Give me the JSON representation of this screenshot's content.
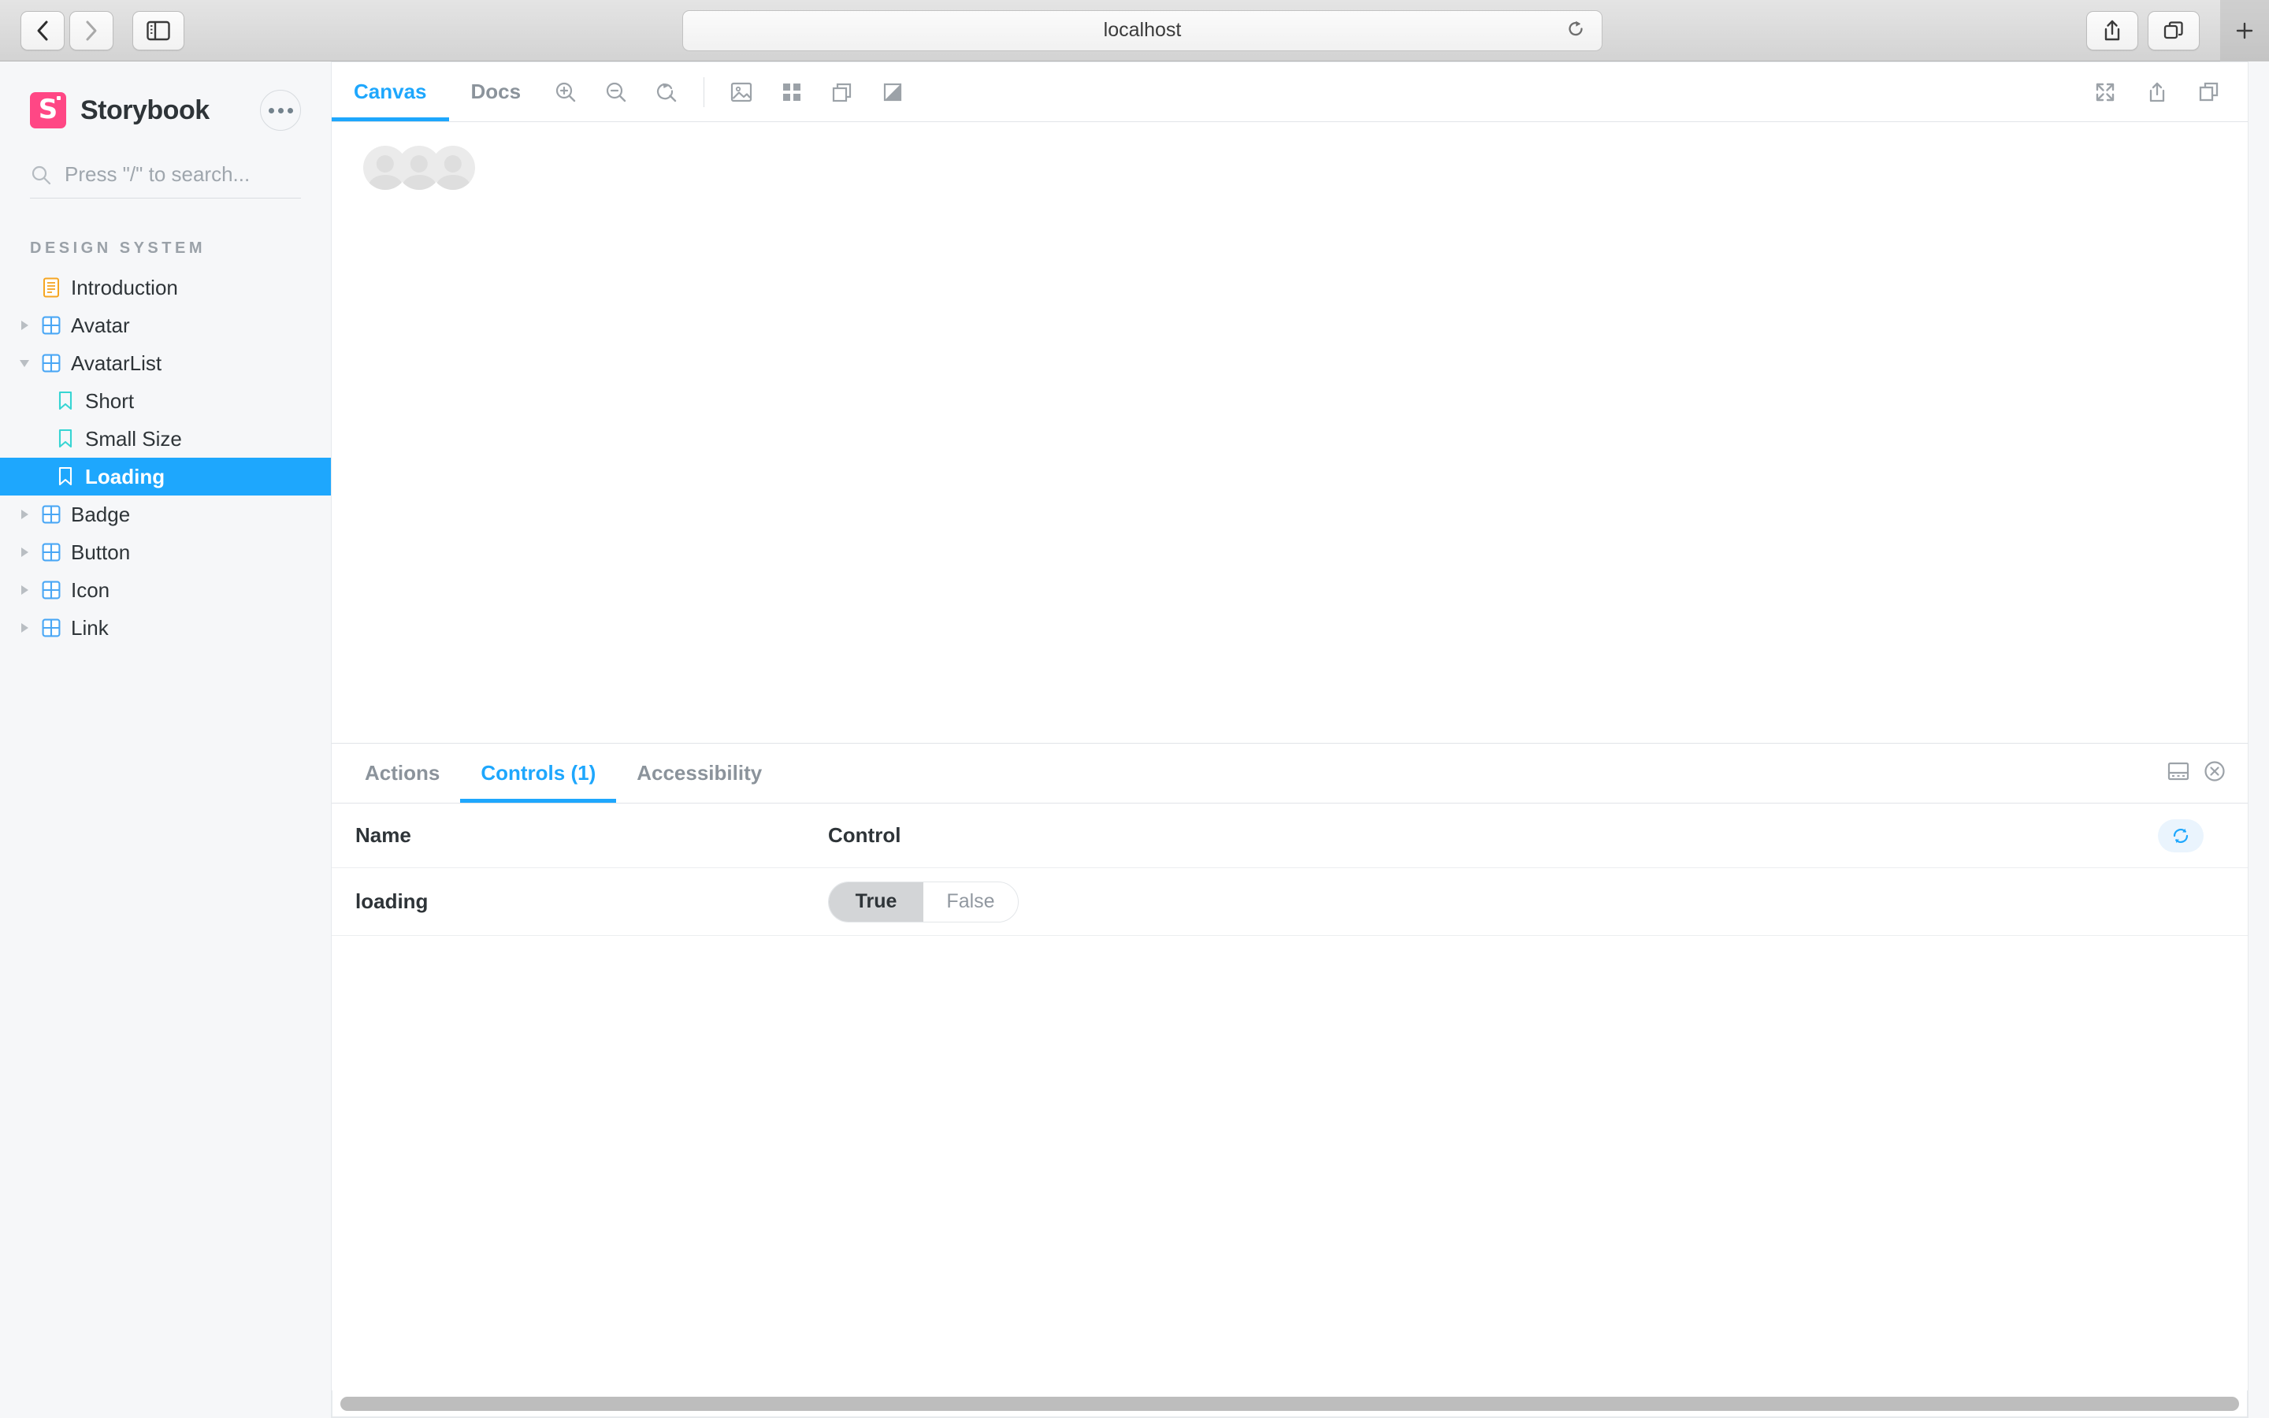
{
  "browser": {
    "back_label": "Back",
    "forward_label": "Forward",
    "sidebar_toggle_label": "Show Sidebar",
    "url": "localhost",
    "reload_label": "Reload",
    "share_label": "Share",
    "tab_overview_label": "Tab Overview",
    "new_tab_label": "+"
  },
  "sidebar": {
    "brand": "Storybook",
    "logo_color": "#ff4785",
    "menu_label": "...",
    "search": {
      "placeholder": "Press \"/\" to search..."
    },
    "section_title": "DESIGN SYSTEM",
    "selection_color": "#1ea7fd",
    "items": [
      {
        "label": "Introduction",
        "icon": "document-icon",
        "depth": 0,
        "expandable": false,
        "selected": false
      },
      {
        "label": "Avatar",
        "icon": "component-icon",
        "depth": 0,
        "expandable": true,
        "expanded": false,
        "selected": false
      },
      {
        "label": "AvatarList",
        "icon": "component-icon",
        "depth": 0,
        "expandable": true,
        "expanded": true,
        "selected": false
      },
      {
        "label": "Short",
        "icon": "story-icon",
        "depth": 1,
        "expandable": false,
        "selected": false
      },
      {
        "label": "Small Size",
        "icon": "story-icon",
        "depth": 1,
        "expandable": false,
        "selected": false
      },
      {
        "label": "Loading",
        "icon": "story-icon",
        "depth": 1,
        "expandable": false,
        "selected": true
      },
      {
        "label": "Badge",
        "icon": "component-icon",
        "depth": 0,
        "expandable": true,
        "expanded": false,
        "selected": false
      },
      {
        "label": "Button",
        "icon": "component-icon",
        "depth": 0,
        "expandable": true,
        "expanded": false,
        "selected": false
      },
      {
        "label": "Icon",
        "icon": "component-icon",
        "depth": 0,
        "expandable": true,
        "expanded": false,
        "selected": false
      },
      {
        "label": "Link",
        "icon": "component-icon",
        "depth": 0,
        "expandable": true,
        "expanded": false,
        "selected": false
      }
    ]
  },
  "toolbar": {
    "tabs": [
      {
        "label": "Canvas",
        "active": true
      },
      {
        "label": "Docs",
        "active": false
      }
    ],
    "tools": [
      {
        "name": "zoom-in-icon",
        "label": "Zoom in"
      },
      {
        "name": "zoom-out-icon",
        "label": "Zoom out"
      },
      {
        "name": "zoom-reset-icon",
        "label": "Reset zoom"
      }
    ],
    "addon_tools": [
      {
        "name": "backgrounds-icon",
        "label": "Change background"
      },
      {
        "name": "grid-icon",
        "label": "Apply grid"
      },
      {
        "name": "measure-icon",
        "label": "Enable measure"
      },
      {
        "name": "outline-icon",
        "label": "Apply outlines"
      }
    ],
    "right_tools": [
      {
        "name": "fullscreen-icon",
        "label": "Go full screen"
      },
      {
        "name": "open-in-new-tab-icon",
        "label": "Open canvas in new tab"
      },
      {
        "name": "copy-canvas-link-icon",
        "label": "Copy canvas link"
      }
    ]
  },
  "canvas": {
    "story": "Loading",
    "avatar_count": 3,
    "placeholder_bg": "#ebebeb",
    "placeholder_fg": "#dedede"
  },
  "panel": {
    "tabs": [
      {
        "label": "Actions",
        "active": false
      },
      {
        "label": "Controls (1)",
        "active": true
      },
      {
        "label": "Accessibility",
        "active": false
      }
    ],
    "right_tools": [
      {
        "name": "panel-position-icon",
        "label": "Change addon orientation"
      },
      {
        "name": "close-panel-icon",
        "label": "Hide addons"
      }
    ],
    "table": {
      "columns": [
        "Name",
        "Control"
      ],
      "reset_label": "Reset controls",
      "rows": [
        {
          "name": "loading",
          "control_type": "boolean",
          "options": [
            {
              "label": "True",
              "selected": true
            },
            {
              "label": "False",
              "selected": false
            }
          ]
        }
      ]
    }
  }
}
